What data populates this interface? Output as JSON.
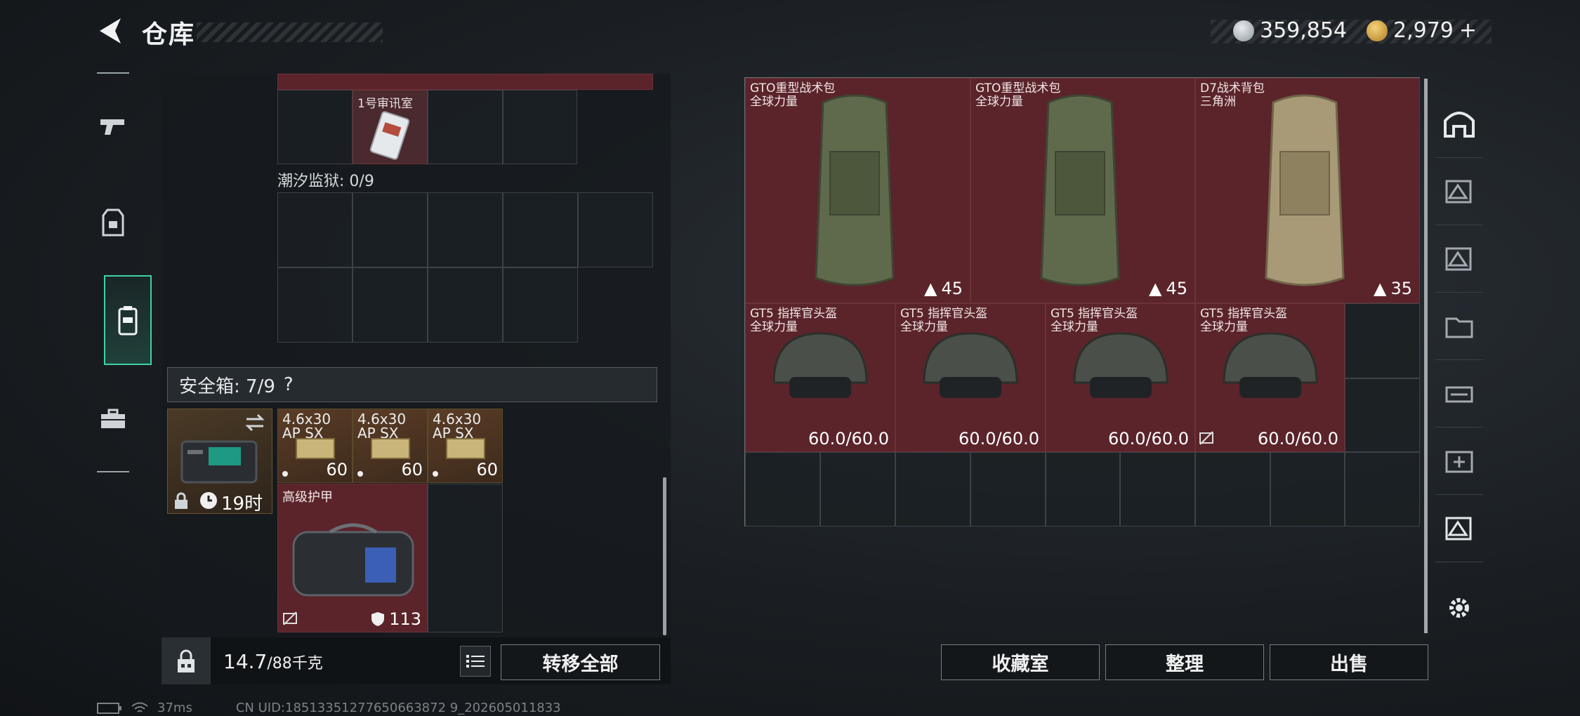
{
  "header": {
    "title": "仓库",
    "currency_silver": "359,854",
    "currency_gold": "2,979",
    "gold_plus": "+"
  },
  "left": {
    "room_label": "1号审讯室",
    "prison_label": "潮汐监狱: 0/9",
    "safebox_label": "安全箱: 7/9",
    "safebox_help": "?",
    "safebox_timer": "19时",
    "ammo": [
      {
        "name": "4.6x30",
        "sub": "AP SX",
        "count": "60"
      },
      {
        "name": "4.6x30",
        "sub": "AP SX",
        "count": "60"
      },
      {
        "name": "4.6x30",
        "sub": "AP SX",
        "count": "60"
      }
    ],
    "armor_item": {
      "name": "高级护甲",
      "durability": "113"
    },
    "weight": "14.7",
    "weight_max": "/88千克",
    "transfer_all": "转移全部"
  },
  "right": {
    "backpacks": [
      {
        "name": "GTO重型战术包",
        "sub": "全球力量",
        "cap": "45"
      },
      {
        "name": "GTO重型战术包",
        "sub": "全球力量",
        "cap": "45"
      },
      {
        "name": "D7战术背包",
        "sub": "三角洲",
        "cap": "35"
      }
    ],
    "helmets": [
      {
        "name": "GT5 指挥官头盔",
        "sub": "全球力量",
        "dur": "60.0/60.0"
      },
      {
        "name": "GT5 指挥官头盔",
        "sub": "全球力量",
        "dur": "60.0/60.0"
      },
      {
        "name": "GT5 指挥官头盔",
        "sub": "全球力量",
        "dur": "60.0/60.0"
      },
      {
        "name": "GT5 指挥官头盔",
        "sub": "全球力量",
        "dur": "60.0/60.0"
      }
    ],
    "buttons": {
      "collection": "收藏室",
      "organize": "整理",
      "sell": "出售"
    }
  },
  "status": {
    "ping": "37ms",
    "uid": "CN UID:18513351277650663872 9_202605011833"
  }
}
